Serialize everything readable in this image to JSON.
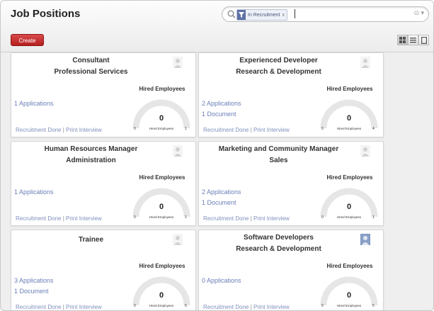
{
  "header": {
    "title": "Job Positions",
    "create_label": "Create"
  },
  "search": {
    "facet_label": "In Recruitment",
    "facet_remove": "x",
    "dropdown": "⊙ ▾"
  },
  "gauge": {
    "title": "Hired Employees",
    "label": "Hired Employees"
  },
  "links": {
    "done": "Recruitment Done",
    "sep": " | ",
    "print": "Print Interview"
  },
  "cards": [
    {
      "title": "Consultant",
      "subtitle": "Professional Services",
      "applications": "1 Applications",
      "documents": "",
      "hired": 0,
      "min": "0",
      "max": "1",
      "avatar": "placeholder"
    },
    {
      "title": "Experienced Developer",
      "subtitle": "Research & Development",
      "applications": "2 Applications",
      "documents": "1 Document",
      "hired": 0,
      "min": "0",
      "max": "4",
      "avatar": "placeholder"
    },
    {
      "title": "Human Resources Manager",
      "subtitle": "Administration",
      "applications": "1 Applications",
      "documents": "",
      "hired": 0,
      "min": "0",
      "max": "1",
      "avatar": "placeholder"
    },
    {
      "title": "Marketing and Community Manager",
      "subtitle": "Sales",
      "applications": "2 Applications",
      "documents": "1 Document",
      "hired": 0,
      "min": "0",
      "max": "1",
      "avatar": "placeholder"
    },
    {
      "title": "Trainee",
      "subtitle": "",
      "applications": "3 Applications",
      "documents": "1 Document",
      "hired": 0,
      "min": "0",
      "max": "6",
      "avatar": "placeholder"
    },
    {
      "title": "Software Developers",
      "subtitle": "Research & Development",
      "applications": "0 Applications",
      "documents": "",
      "hired": 0,
      "min": "0",
      "max": "5",
      "avatar": "photo"
    }
  ],
  "colors": {
    "create": "#c62d2d",
    "link": "#6b7fb7",
    "gauge_track": "#e6e6e6"
  }
}
